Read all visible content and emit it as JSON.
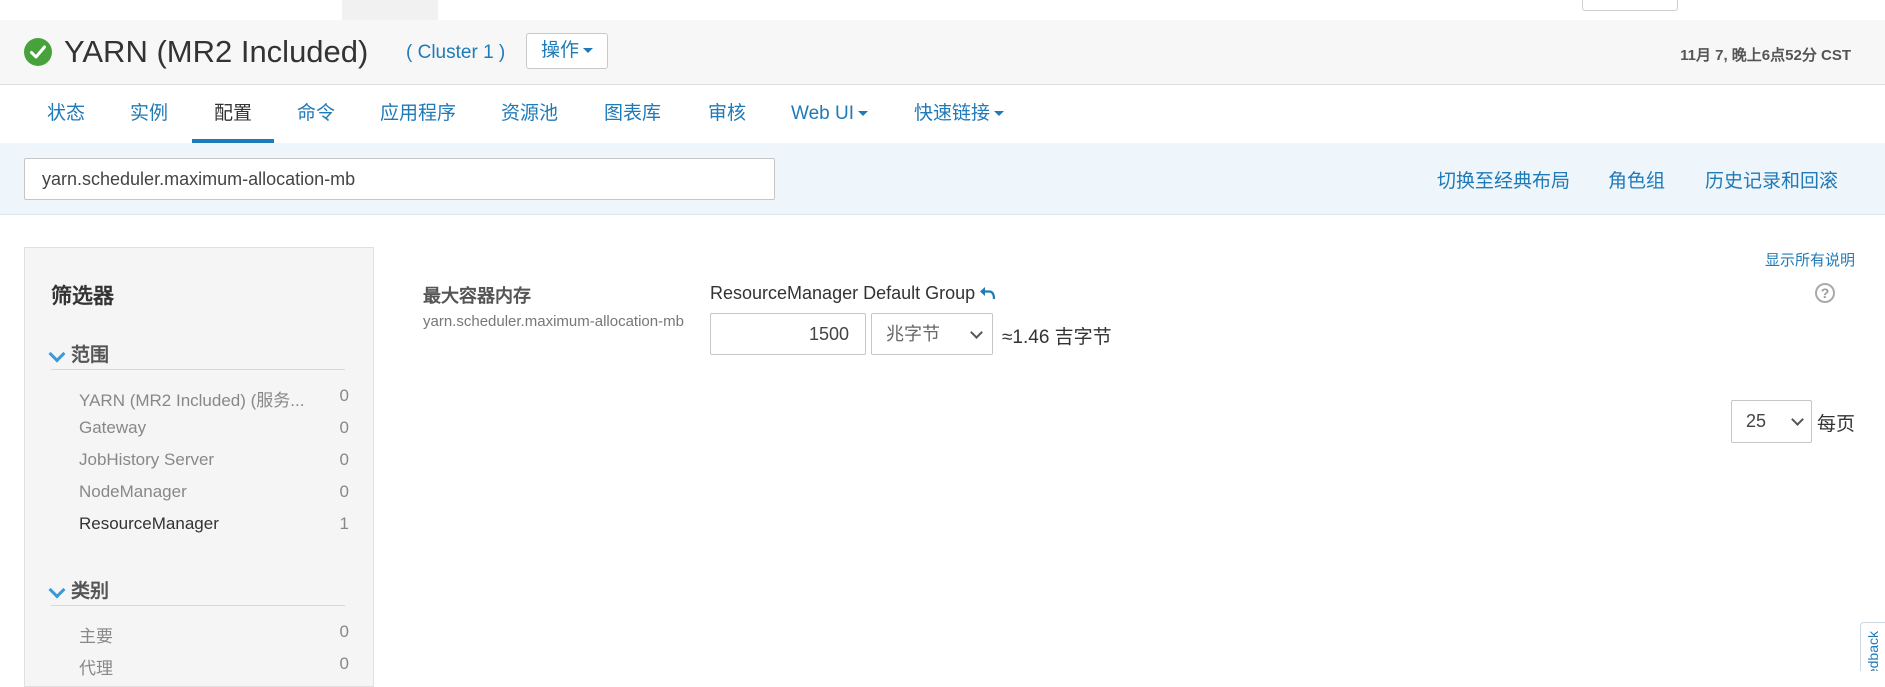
{
  "service": {
    "title": "YARN (MR2 Included)",
    "cluster_link": "( Cluster 1 )",
    "actions_label": "操作",
    "timestamp": "11月 7, 晚上6点52分 CST"
  },
  "tabs": [
    {
      "label": "状态"
    },
    {
      "label": "实例"
    },
    {
      "label": "配置",
      "active": true
    },
    {
      "label": "命令"
    },
    {
      "label": "应用程序"
    },
    {
      "label": "资源池"
    },
    {
      "label": "图表库"
    },
    {
      "label": "审核"
    },
    {
      "label": "Web UI"
    },
    {
      "label": "快速链接"
    }
  ],
  "toolbar": {
    "search_value": "yarn.scheduler.maximum-allocation-mb",
    "classic_layout_link": "切换至经典布局",
    "role_groups_link": "角色组",
    "history_link": "历史记录和回滚"
  },
  "filters": {
    "title": "筛选器",
    "scope": {
      "label": "范围",
      "items": [
        {
          "name": "YARN (MR2 Included) (服务...",
          "count": "0"
        },
        {
          "name": "Gateway",
          "count": "0"
        },
        {
          "name": "JobHistory Server",
          "count": "0"
        },
        {
          "name": "NodeManager",
          "count": "0"
        },
        {
          "name": "ResourceManager",
          "count": "1"
        }
      ]
    },
    "category": {
      "label": "类别",
      "items": [
        {
          "name": "主要",
          "count": "0"
        },
        {
          "name": "代理",
          "count": "0"
        }
      ]
    }
  },
  "config": {
    "show_all_desc": "显示所有说明",
    "property_label": "最大容器内存",
    "property_key": "yarn.scheduler.maximum-allocation-mb",
    "group_name": "ResourceManager Default Group",
    "value": "1500",
    "unit": "兆字节",
    "approx": "≈1.46 吉字节"
  },
  "pagination": {
    "per_page_value": "25",
    "per_page_label": "每页"
  },
  "feedback_label": "Feedback",
  "colors": {
    "link": "#1f7ab8",
    "status_ok": "#48a23b",
    "toolbar_bg": "#eef5fb"
  }
}
